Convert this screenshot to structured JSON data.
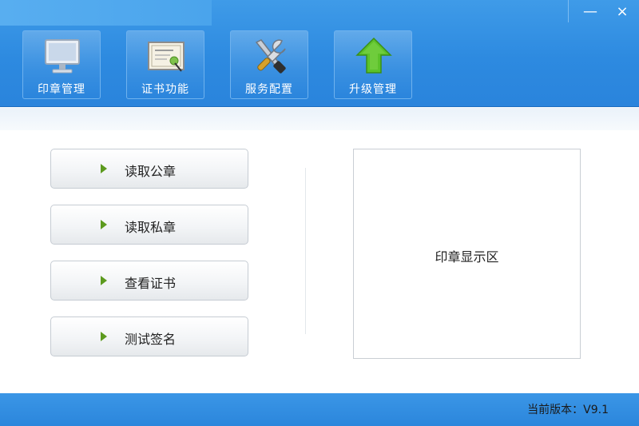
{
  "window": {
    "minimize_glyph": "—",
    "close_glyph": "×"
  },
  "toolbar": {
    "items": [
      {
        "label": "印章管理",
        "icon": "monitor-icon"
      },
      {
        "label": "证书功能",
        "icon": "certificate-icon"
      },
      {
        "label": "服务配置",
        "icon": "tools-icon"
      },
      {
        "label": "升级管理",
        "icon": "upgrade-arrow-icon"
      }
    ]
  },
  "actions": {
    "items": [
      {
        "label": "读取公章"
      },
      {
        "label": "读取私章"
      },
      {
        "label": "查看证书"
      },
      {
        "label": "测试签名"
      }
    ]
  },
  "seal_display": {
    "label": "印章显示区"
  },
  "status": {
    "version": "当前版本：V9.1"
  },
  "colors": {
    "header_blue": "#2d8ae0",
    "arrow_green": "#5c9a1e",
    "upgrade_green": "#5cc22a"
  }
}
